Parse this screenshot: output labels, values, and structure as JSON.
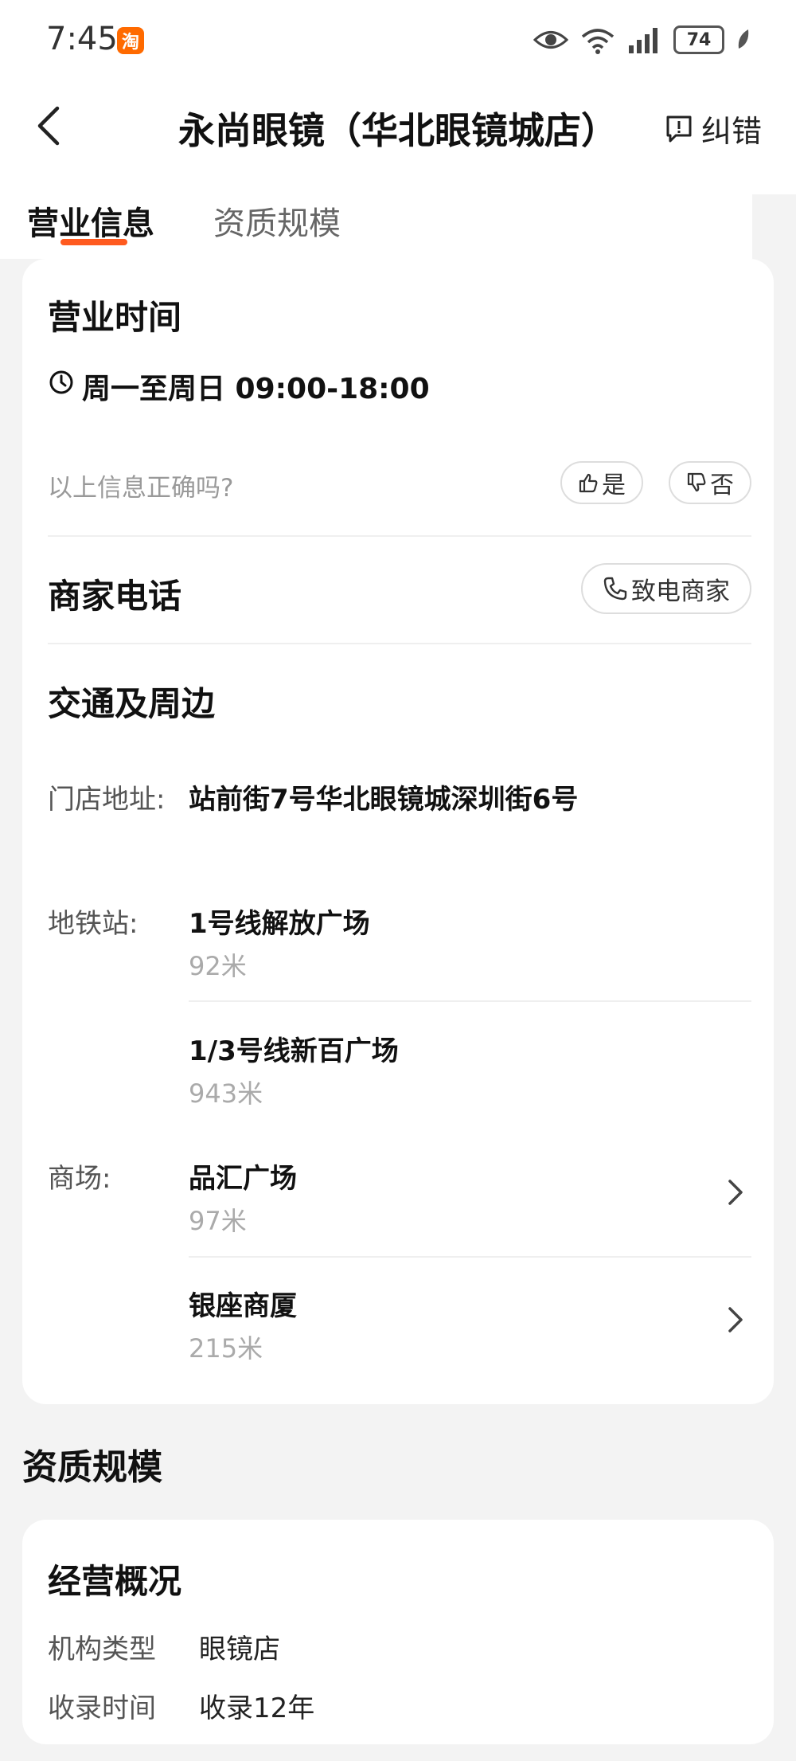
{
  "status_bar": {
    "time": "7:45",
    "app_badge": "淘",
    "battery": "74",
    "icons": [
      "eye-icon",
      "wifi-icon",
      "signal-icon",
      "battery-icon",
      "leaf-icon"
    ]
  },
  "header": {
    "title": "永尚眼镜（华北眼镜城店）",
    "report_label": "纠错"
  },
  "tabs": [
    {
      "label": "营业信息",
      "active": true
    },
    {
      "label": "资质规模",
      "active": false
    }
  ],
  "business_hours": {
    "heading": "营业时间",
    "hours": "周一至周日 09:00-18:00",
    "question": "以上信息正确吗?",
    "yes_label": "是",
    "no_label": "否"
  },
  "phone": {
    "heading": "商家电话",
    "call_label": "致电商家"
  },
  "transport": {
    "heading": "交通及周边",
    "address_label": "门店地址:",
    "address": "站前街7号华北眼镜城深圳街6号",
    "subway_label": "地铁站:",
    "subway": [
      {
        "name": "1号线解放广场",
        "distance": "92米"
      },
      {
        "name": "1/3号线新百广场",
        "distance": "943米"
      }
    ],
    "mall_label": "商场:",
    "malls": [
      {
        "name": "品汇广场",
        "distance": "97米"
      },
      {
        "name": "银座商厦",
        "distance": "215米"
      }
    ]
  },
  "qualification": {
    "section_title": "资质规模",
    "card_title": "经营概况",
    "rows": [
      {
        "label": "机构类型",
        "value": "眼镜店"
      },
      {
        "label": "收录时间",
        "value": "收录12年"
      }
    ]
  },
  "colors": {
    "accent": "#ff5a1f",
    "badge": "#ff6a00",
    "background": "#f3f3f3"
  }
}
